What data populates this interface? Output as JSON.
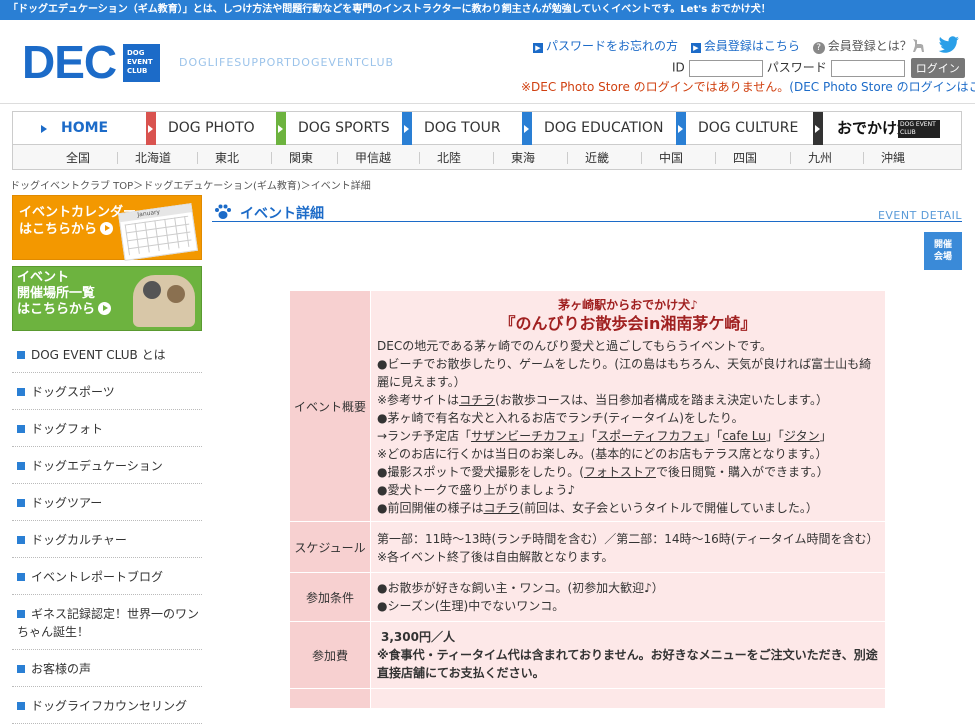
{
  "topbar": {
    "text": "「ドッグエデュケーション（ギム教育）」とは、しつけ方法や問題行動などを専門のインストラクターに教わり飼主さんが勉強していくイベントです。Let's おでかけ犬！"
  },
  "header": {
    "logo_text": "DEC",
    "logo_box": "DOG EVENT CLUB",
    "tagline": "DOGLIFESUPPORTDOGEVENTCLUB",
    "links": {
      "forgot_password": "パスワードをお忘れの方",
      "register": "会員登録はこちら",
      "about_membership": "会員登録とは？"
    },
    "login": {
      "id_label": "ID",
      "password_label": "パスワード",
      "button": "ログイン"
    },
    "photo_store_note": "※DEC Photo Store のログインではありません。",
    "photo_store_link": "(DEC Photo Store のログインはこちら)"
  },
  "nav": {
    "main": [
      {
        "label": "HOME",
        "color": "#ffffff"
      },
      {
        "label": "DOG PHOTO",
        "color": "#d9534f"
      },
      {
        "label": "DOG SPORTS",
        "color": "#6db33f"
      },
      {
        "label": "DOG TOUR",
        "color": "#2a7fd4"
      },
      {
        "label": "DOG EDUCATION",
        "color": "#2a7fd4"
      },
      {
        "label": "DOG CULTURE",
        "color": "#2a7fd4"
      },
      {
        "label": "おでかけ犬",
        "color": "#333333"
      }
    ],
    "odekake_box": "DOG EVENT CLUB",
    "regions": [
      "全国",
      "北海道",
      "東北",
      "関東",
      "甲信越",
      "北陸",
      "東海",
      "近畿",
      "中国",
      "四国",
      "九州",
      "沖縄"
    ]
  },
  "breadcrumb": "ドッグイベントクラブ TOP＞ドッグエデュケーション(ギム教育)＞イベント詳細",
  "sidebar": {
    "banner_calendar": {
      "line1": "イベントカレンダー",
      "line2": "はこちらから",
      "calendar_month": "January"
    },
    "banner_venues": {
      "line1": "イベント",
      "line2": "開催場所一覧",
      "line3": "はこちらから"
    },
    "menu": [
      "DOG EVENT CLUB とは",
      "ドッグスポーツ",
      "ドッグフォト",
      "ドッグエデュケーション",
      "ドッグツアー",
      "ドッグカルチャー",
      "イベントレポートブログ",
      "ギネス記録認定！世界一のワンちゃん誕生！",
      "お客様の声",
      "ドッグライフカウンセリング"
    ]
  },
  "main": {
    "section_title": "イベント詳細",
    "section_en": "EVENT DETAIL",
    "venue_button": [
      "開催",
      "会場"
    ],
    "event": {
      "subtitle": "茅ヶ崎駅からおでかけ犬♪",
      "title": "『のんびりお散歩会in湘南茅ケ崎』",
      "overview_label": "イベント概要",
      "overview": {
        "l1": "DECの地元である茅ヶ崎でのんびり愛犬と過ごしてもらうイベントです。",
        "l2": "●ビーチでお散歩したり、ゲームをしたり。(江の島はもちろん、天気が良ければ富士山も綺麗に見えます。）",
        "l3a": "※参考サイトは",
        "l3link": "コチラ",
        "l3b": "(お散歩コースは、当日参加者構成を踏まえ決定いたします。）",
        "l4": "●茅ヶ崎で有名な犬と入れるお店でランチ(ティータイム)をしたり。",
        "l5a": "→ランチ予定店「",
        "l5s1": "サザンビーチカフェ",
        "l5m1": "」「",
        "l5s2": "スポーティフカフェ",
        "l5m2": "」「",
        "l5s3": "cafe Lu",
        "l5m3": "」「",
        "l5s4": "ジタン",
        "l5b": "」",
        "l6": "※どのお店に行くかは当日のお楽しみ。(基本的にどのお店もテラス席となります。）",
        "l7a": "●撮影スポットで愛犬撮影をしたり。(",
        "l7link": "フォトストア",
        "l7b": "で後日閲覧・購入ができます。）",
        "l8": "●愛犬トークで盛り上がりましょう♪",
        "l9a": "●前回開催の様子は",
        "l9link": "コチラ",
        "l9b": "(前回は、女子会というタイトルで開催していました。）"
      },
      "schedule_label": "スケジュール",
      "schedule": {
        "l1": "第一部：11時～13時(ランチ時間を含む）／第二部：14時～16時(ティータイム時間を含む）",
        "l2": "※各イベント終了後は自由解散となります。"
      },
      "conditions_label": "参加条件",
      "conditions": {
        "l1": "●お散歩が好きな飼い主・ワンコ。(初参加大歓迎♪）",
        "l2": "●シーズン(生理)中でないワンコ。"
      },
      "fee_label": "参加費",
      "fee": {
        "l1": "3,300円／人",
        "l2": "※食事代・ティータイム代は含まれておりません。お好きなメニューをご注文いただき、別途直接店舗にてお支払ください。"
      }
    }
  }
}
